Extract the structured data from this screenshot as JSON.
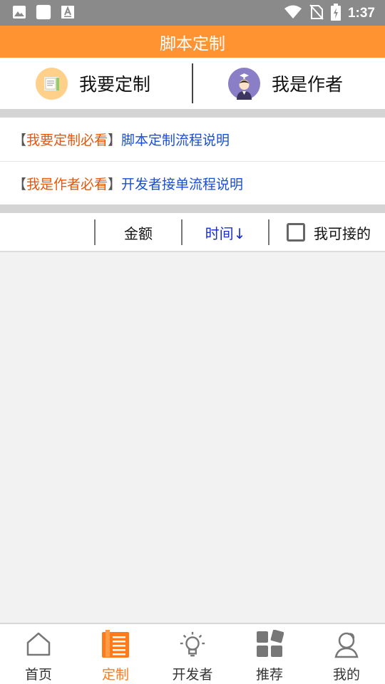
{
  "status_bar": {
    "time": "1:37",
    "left_icons": [
      "image-icon",
      "square-icon",
      "font-icon"
    ],
    "right_icons": [
      "wifi-icon",
      "no-sim-icon",
      "battery-charging-icon"
    ]
  },
  "title_bar": {
    "title": "脚本定制"
  },
  "modes": [
    {
      "label": "我要定制",
      "icon": "customize-icon"
    },
    {
      "label": "我是作者",
      "icon": "author-avatar-icon"
    }
  ],
  "notices": [
    {
      "open": "【",
      "tag": "我要定制必看",
      "close": "】",
      "link": "脚本定制流程说明"
    },
    {
      "open": "【",
      "tag": "我是作者必看",
      "close": "】",
      "link": "开发者接单流程说明"
    }
  ],
  "filters": {
    "amount": "金额",
    "time": "时间↓",
    "can_accept": "我可接的",
    "can_accept_checked": false
  },
  "bottom_nav": {
    "active": "定制",
    "items": [
      {
        "label": "首页",
        "icon": "home-icon"
      },
      {
        "label": "定制",
        "icon": "book-icon"
      },
      {
        "label": "开发者",
        "icon": "lightbulb-icon"
      },
      {
        "label": "推荐",
        "icon": "apps-icon"
      },
      {
        "label": "我的",
        "icon": "profile-icon"
      }
    ]
  },
  "colors": {
    "accent": "#ff9331",
    "status_bar": "#8a8a8a",
    "tag_text": "#e8560b",
    "link_text": "#1a4ed8",
    "active_sort": "#1a2fd0"
  }
}
